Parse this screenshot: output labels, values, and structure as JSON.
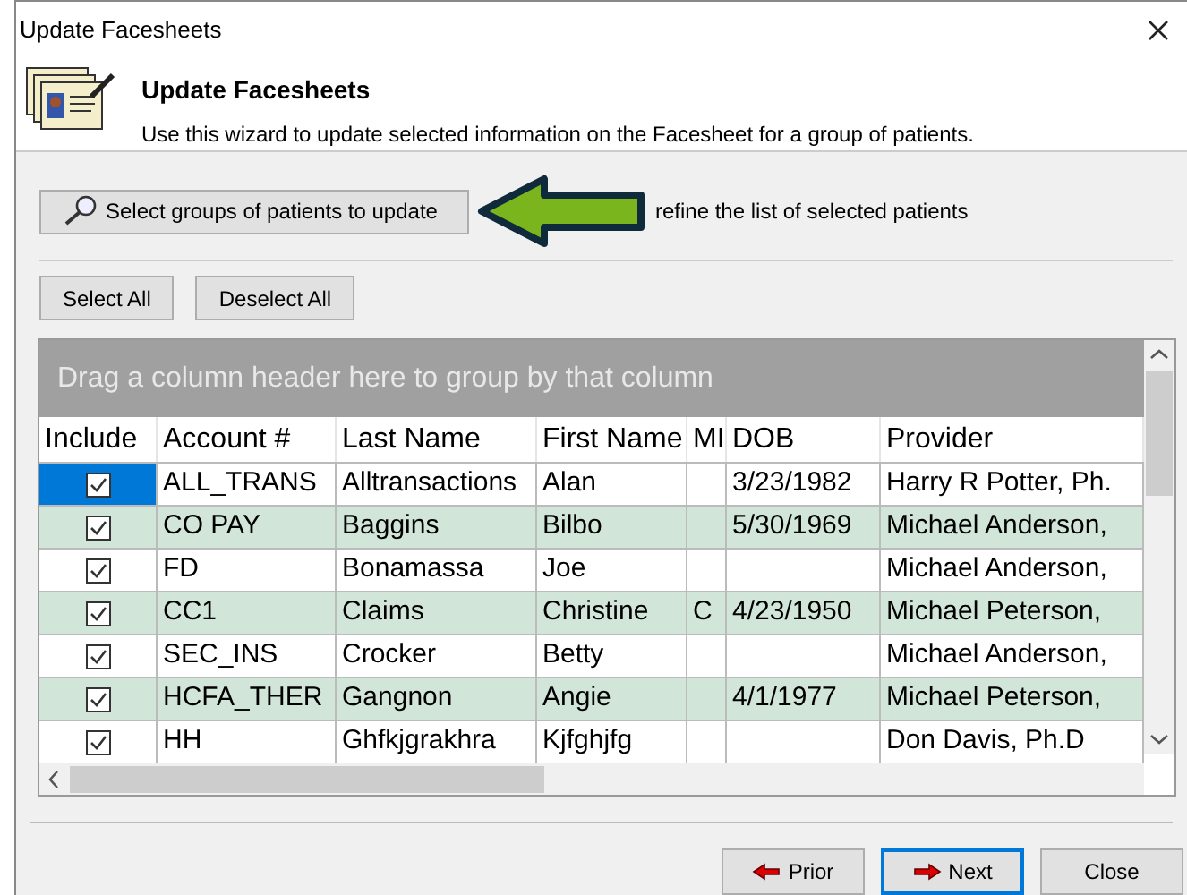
{
  "window": {
    "title": "Update Facesheets"
  },
  "header": {
    "title": "Update Facesheets",
    "description": "Use this wizard to update selected information on the Facesheet for a group of patients."
  },
  "select_groups_button": "Select groups of patients to update",
  "hint": "refine the list of selected patients",
  "selection_buttons": [
    "Select All",
    "Deselect All"
  ],
  "grid": {
    "group_panel": "Drag a column header here to group by that column",
    "include_column": "Include",
    "columns": [
      "Account #",
      "Last Name",
      "First Name",
      "MI",
      "DOB",
      "Provider"
    ],
    "rows": [
      {
        "selected": true,
        "checked": true,
        "cells": [
          "ALL_TRANS",
          "Alltransactions",
          "Alan",
          "",
          "3/23/1982",
          "Harry R Potter, Ph."
        ]
      },
      {
        "selected": false,
        "checked": true,
        "cells": [
          "CO PAY",
          "Baggins",
          "Bilbo",
          "",
          "5/30/1969",
          "Michael Anderson,"
        ]
      },
      {
        "selected": false,
        "checked": true,
        "cells": [
          "FD",
          "Bonamassa",
          "Joe",
          "",
          "",
          "Michael Anderson,"
        ]
      },
      {
        "selected": false,
        "checked": true,
        "cells": [
          "CC1",
          "Claims",
          "Christine",
          "C",
          "4/23/1950",
          "Michael Peterson,"
        ]
      },
      {
        "selected": false,
        "checked": true,
        "cells": [
          "SEC_INS",
          "Crocker",
          "Betty",
          "",
          "",
          "Michael Anderson,"
        ]
      },
      {
        "selected": false,
        "checked": true,
        "cells": [
          "HCFA_THER",
          "Gangnon",
          "Angie",
          "",
          "4/1/1977",
          "Michael Peterson,"
        ]
      },
      {
        "selected": false,
        "checked": true,
        "cells": [
          "HH",
          "Ghfkjgrakhra",
          "Kjfghjfg",
          "",
          "",
          "Don Davis, Ph.D"
        ]
      }
    ]
  },
  "nav_buttons": [
    {
      "label": "Prior",
      "kind": "back",
      "default": false
    },
    {
      "label": "Next",
      "kind": "forward",
      "default": true
    },
    {
      "label": "Close",
      "kind": "plain",
      "default": false
    }
  ]
}
